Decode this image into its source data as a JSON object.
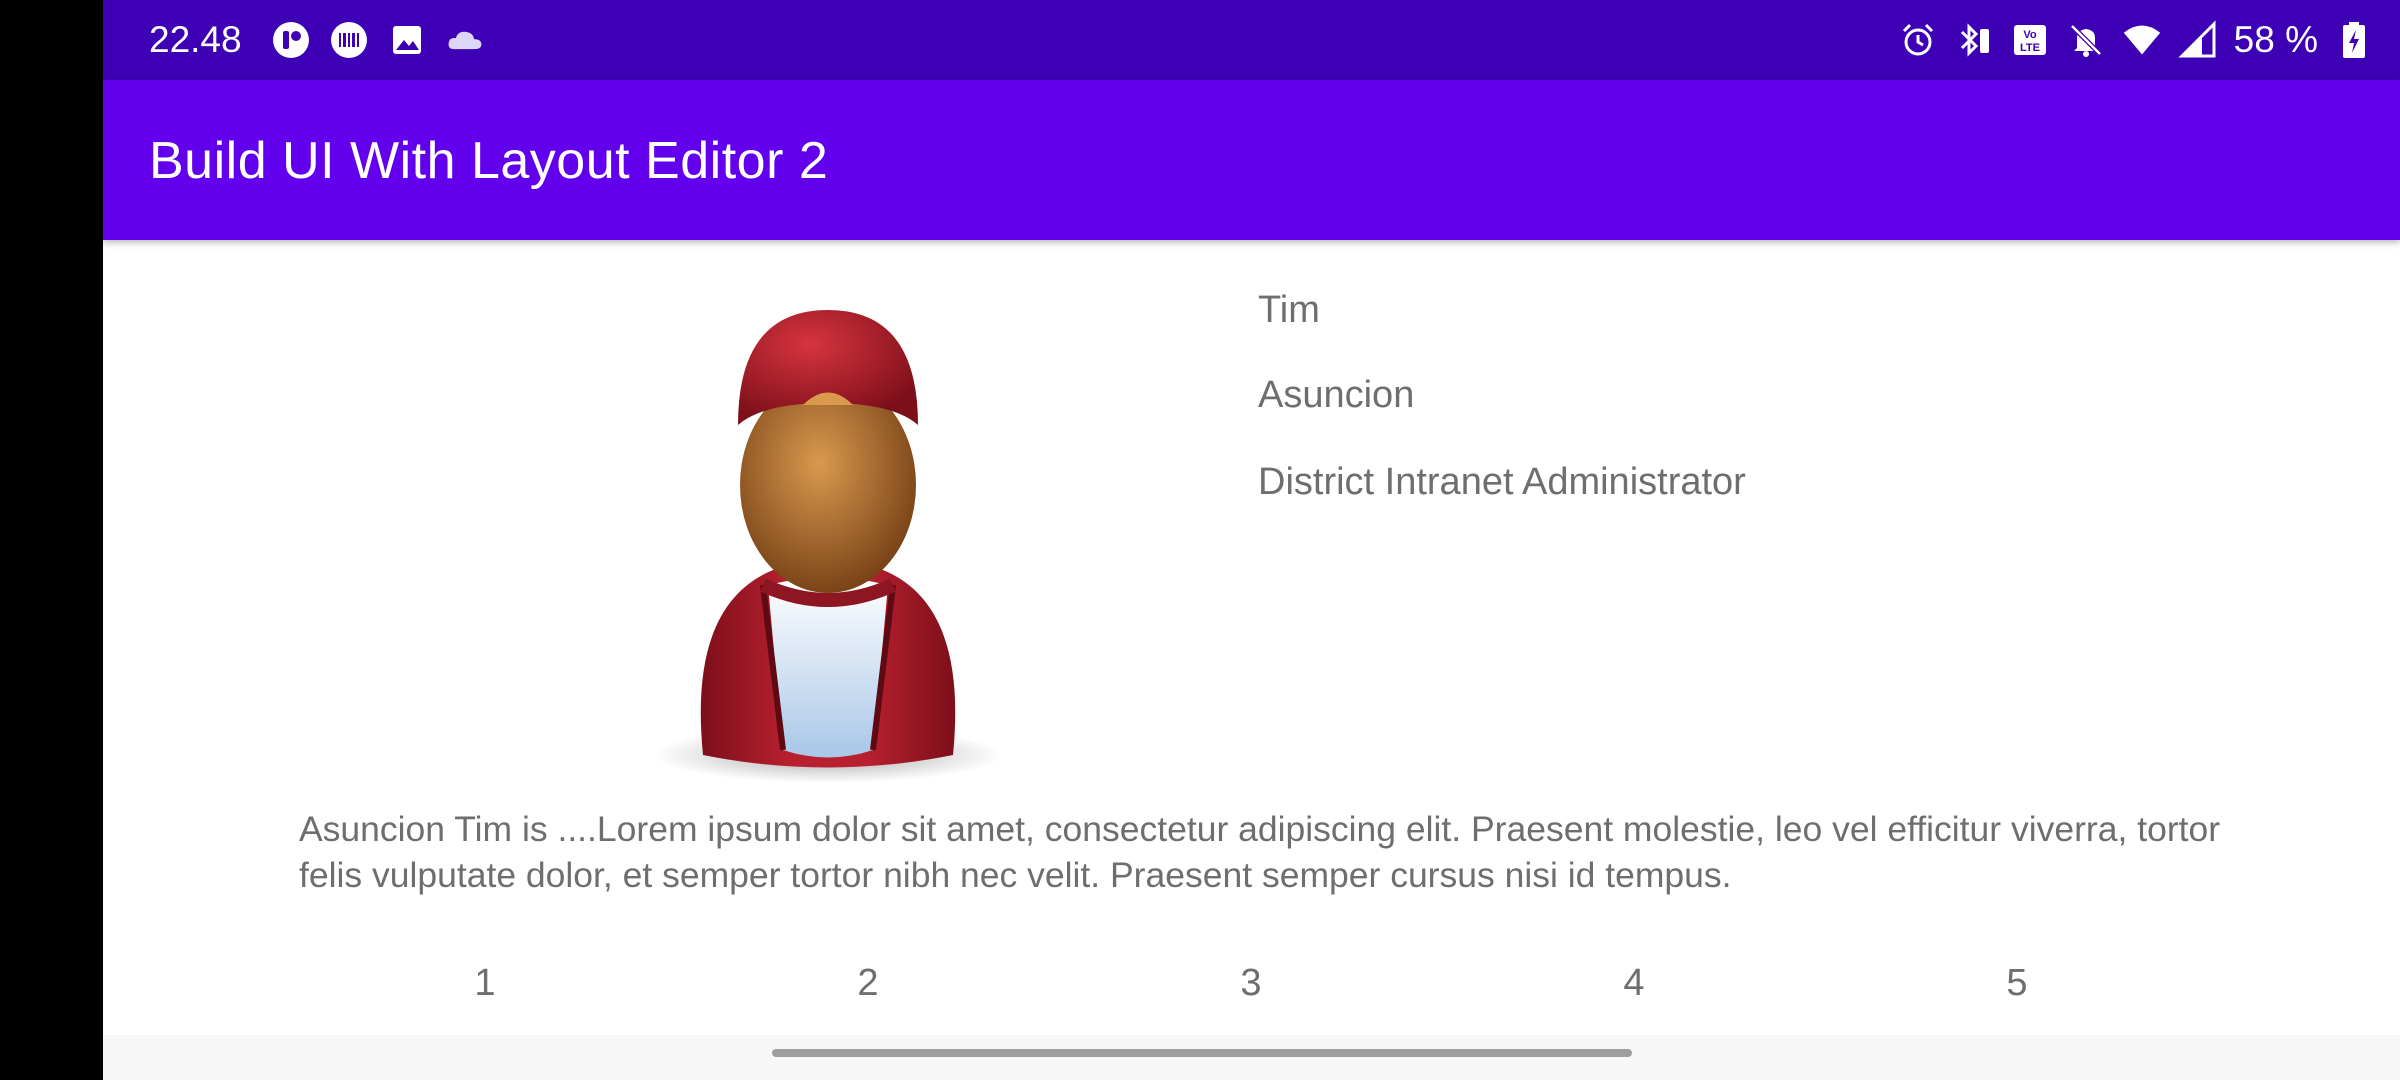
{
  "status_bar": {
    "time": "22.48",
    "battery_percent": "58 %",
    "background_color": "#3d00b5",
    "left_icons": [
      "profile-app-icon",
      "barcode-app-icon",
      "image-icon",
      "cloud-icon"
    ],
    "right_icons": [
      "alarm-icon",
      "bluetooth-battery-icon",
      "volte-icon",
      "notifications-muted-icon",
      "wifi-icon",
      "cell-signal-icon",
      "battery-charging-icon"
    ]
  },
  "app_bar": {
    "title": "Build UI With Layout Editor 2",
    "background_color": "#6200ee"
  },
  "profile": {
    "avatar_icon": "user-avatar-red-cap",
    "first_name": "Tim",
    "last_name": "Asuncion",
    "job_title": "District Intranet Administrator",
    "bio": "Asuncion Tim is ....Lorem ipsum dolor sit amet, consectetur adipiscing elit. Praesent molestie, leo vel efficitur viverra, tortor felis vulputate dolor, et semper tortor nibh nec velit. Praesent semper cursus nisi id tempus."
  },
  "number_row": [
    "1",
    "2",
    "3",
    "4",
    "5"
  ],
  "text_color": "#6e6e6e"
}
